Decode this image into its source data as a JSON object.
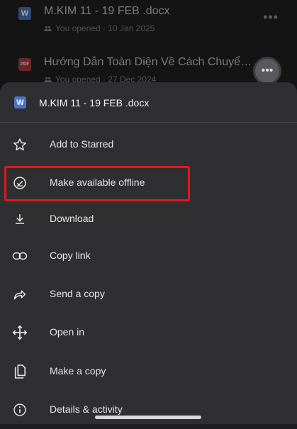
{
  "background_files": [
    {
      "name": "M.KIM 11 - 19 FEB .docx",
      "meta": "You opened · 10 Jan 2025",
      "icon": "W"
    },
    {
      "name": "Hướng Dẫn Toàn Diện Về Cách Chuyển Đ...",
      "meta": "You opened · 27 Dec 2024",
      "icon": "PDF"
    }
  ],
  "sheet": {
    "file_icon": "W",
    "title": "M.KIM 11 - 19 FEB .docx",
    "items": [
      {
        "label": "Add to Starred",
        "icon": "star-icon"
      },
      {
        "label": "Make available offline",
        "icon": "offline-check-icon"
      },
      {
        "label": "Download",
        "icon": "download-icon"
      },
      {
        "label": "Copy link",
        "icon": "link-icon"
      },
      {
        "label": "Send a copy",
        "icon": "share-arrow-icon"
      },
      {
        "label": "Open in",
        "icon": "move-arrows-icon"
      },
      {
        "label": "Make a copy",
        "icon": "copy-icon"
      },
      {
        "label": "Details & activity",
        "icon": "info-icon"
      }
    ]
  },
  "colors": {
    "highlight": "#e4161b",
    "sheet_bg": "#2f2f31",
    "word_blue": "#4a74c9"
  }
}
